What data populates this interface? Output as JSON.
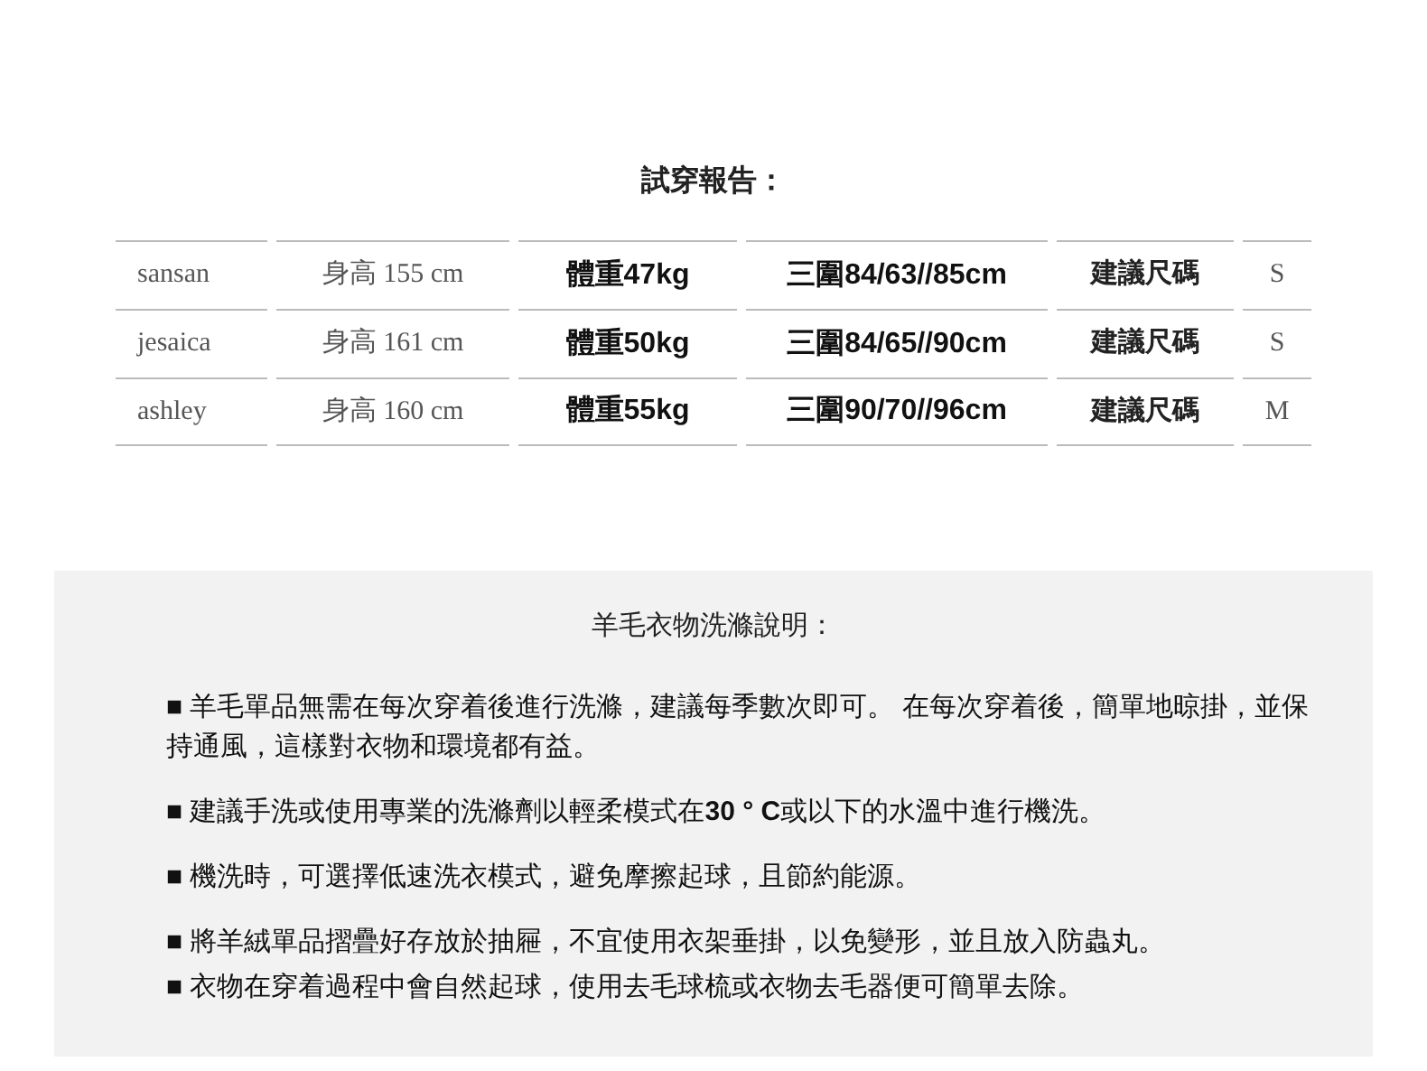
{
  "report": {
    "title": "試穿報告：",
    "rows": [
      [
        "sansan",
        "身高 155 cm",
        "體重47kg",
        "三圍84/63//85cm",
        "建議尺碼",
        "S"
      ],
      [
        "jesaica",
        "身高 161 cm",
        "體重50kg",
        "三圍84/65//90cm",
        "建議尺碼",
        "S"
      ],
      [
        "ashley",
        "身高 160 cm",
        "體重55kg",
        "三圍90/70//96cm",
        "建議尺碼",
        "M"
      ]
    ]
  },
  "care": {
    "title": "羊毛衣物洗滌說明：",
    "groups": [
      [
        "■ 羊毛單品無需在每次穿着後進行洗滌，建議每季數次即可。 在每次穿着後，簡單地晾掛，並保持通風，這樣對衣物和環境都有益。"
      ],
      [
        "■ 建議手洗或使用專業的洗滌劑以輕柔模式在**30 ° C**或以下的水溫中進行機洗。"
      ],
      [
        "■ 機洗時，可選擇低速洗衣模式，避免摩擦起球，且節約能源。"
      ],
      [
        "■ 將羊絨單品摺疊好存放於抽屜，不宜使用衣架垂掛，以免變形，並且放入防蟲丸。",
        "■ 衣物在穿着過程中會自然起球，使用去毛球梳或衣物去毛器便可簡單去除。"
      ]
    ]
  }
}
